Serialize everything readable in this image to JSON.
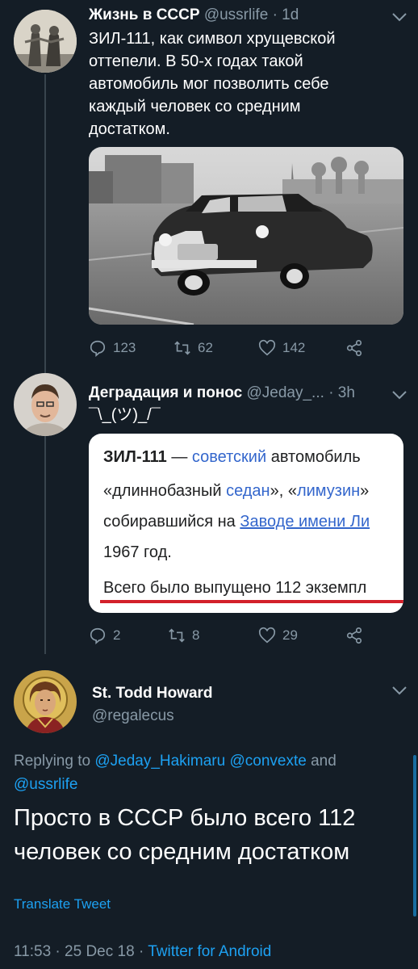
{
  "tweets": [
    {
      "display_name": "Жизнь в СССР",
      "handle": "@ussrlife",
      "time": "· 1d",
      "text": "ЗИЛ-111, как символ хрущевской оттепели. В 50-х годах такой автомобиль мог позволить себе каждый человек со средним достатком.",
      "replies": "123",
      "retweets": "62",
      "likes": "142"
    },
    {
      "display_name": "Деградация и понос",
      "handle": "@Jeday_...",
      "time": "· 3h",
      "text": "¯\\_(ツ)_/¯",
      "replies": "2",
      "retweets": "8",
      "likes": "29",
      "image_text": {
        "line1_bold": "ЗИЛ-111",
        "line1_dash": " — ",
        "line1_link": "советский",
        "line1_rest": " автомобиль",
        "line2_a": "«длиннобазный ",
        "line2_link1": "седан",
        "line2_b": "», «",
        "line2_link2": "лимузин",
        "line2_c": "»",
        "line3_a": "собиравшийся на ",
        "line3_link": "Заводе имени Ли",
        "line4": "1967 год.",
        "line5": "Всего было выпущено 112 экземпл"
      }
    }
  ],
  "main_tweet": {
    "display_name": "St. Todd Howard",
    "handle": "@regalecus",
    "replying_prefix": "Replying to",
    "replying_users": "@Jeday_Hakimaru @convexte",
    "replying_and": "and",
    "replying_last": "@ussrlife",
    "text": "Просто в СССР было всего 112 человек со средним достатком",
    "translate": "Translate Tweet",
    "time": "11:53",
    "sep1": "·",
    "date": "25 Dec 18",
    "sep2": "·",
    "source": "Twitter for Android"
  },
  "colors": {
    "background": "#141d26",
    "accent": "#1da1f2",
    "secondary_text": "#8899a6",
    "underline_red": "#d3202a"
  },
  "icons": [
    "chevron-down-icon",
    "reply-icon",
    "retweet-icon",
    "like-icon",
    "share-icon"
  ]
}
